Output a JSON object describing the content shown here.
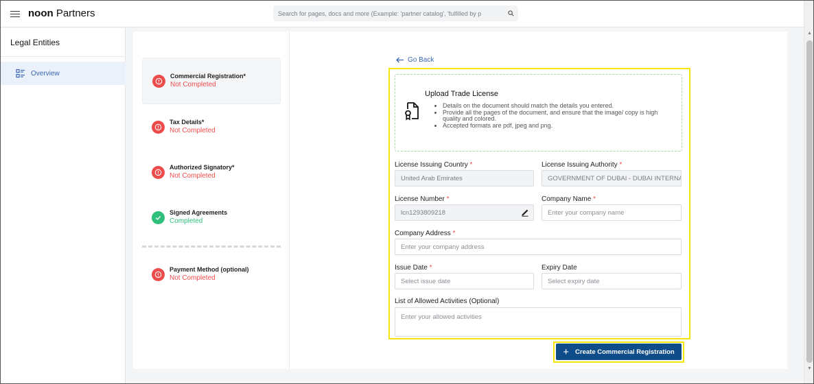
{
  "header": {
    "brand_bold": "noon",
    "brand_rest": " Partners",
    "search_placeholder": "Search for pages, docs and more (Example: 'partner catalog', 'fulfilled by p"
  },
  "sidebar": {
    "title": "Legal Entities",
    "items": [
      {
        "label": "Overview",
        "icon": "list-icon",
        "active": true
      }
    ]
  },
  "steps": [
    {
      "name": "Commercial Registration*",
      "status": "Not Completed",
      "state": "incomplete",
      "active": true
    },
    {
      "name": "Tax Details*",
      "status": "Not Completed",
      "state": "incomplete"
    },
    {
      "name": "Authorized Signatory*",
      "status": "Not Completed",
      "state": "incomplete"
    },
    {
      "name": "Signed Agreements",
      "status": "Completed",
      "state": "complete"
    },
    {
      "name": "Payment Method (optional)",
      "status": "Not Completed",
      "state": "incomplete"
    }
  ],
  "form": {
    "go_back": "Go Back",
    "upload": {
      "title": "Upload Trade License",
      "bullets": [
        "Details on the document should match the details you entered.",
        "Provide all the pages of the document, and ensure that the image/ copy is high quality and colored.",
        "Accepted formats are pdf, jpeg and png."
      ]
    },
    "license_country": {
      "label": "License Issuing Country",
      "value": "United Arab Emirates"
    },
    "license_authority": {
      "label": "License Issuing Authority",
      "value": "GOVERNMENT OF DUBAI - DUBAI INTERNA"
    },
    "license_number": {
      "label": "License Number",
      "value": "lcn1293809218"
    },
    "company_name": {
      "label": "Company Name",
      "placeholder": "Enter your company name"
    },
    "company_address": {
      "label": "Company Address",
      "placeholder": "Enter your company address"
    },
    "issue_date": {
      "label": "Issue Date",
      "placeholder": "Select issue date"
    },
    "expiry_date": {
      "label": "Expiry Date",
      "placeholder": "Select expiry date"
    },
    "activities": {
      "label": "List of Allowed Activities (Optional)",
      "placeholder": "Enter your allowed activities"
    },
    "required_mark": "*",
    "submit_label": "Create Commercial Registration"
  },
  "colors": {
    "accent": "#3b66b3",
    "error": "#ee4b4b",
    "success": "#2fbf7a",
    "primary_button": "#0f4c8a",
    "highlight": "#f5e60a"
  }
}
